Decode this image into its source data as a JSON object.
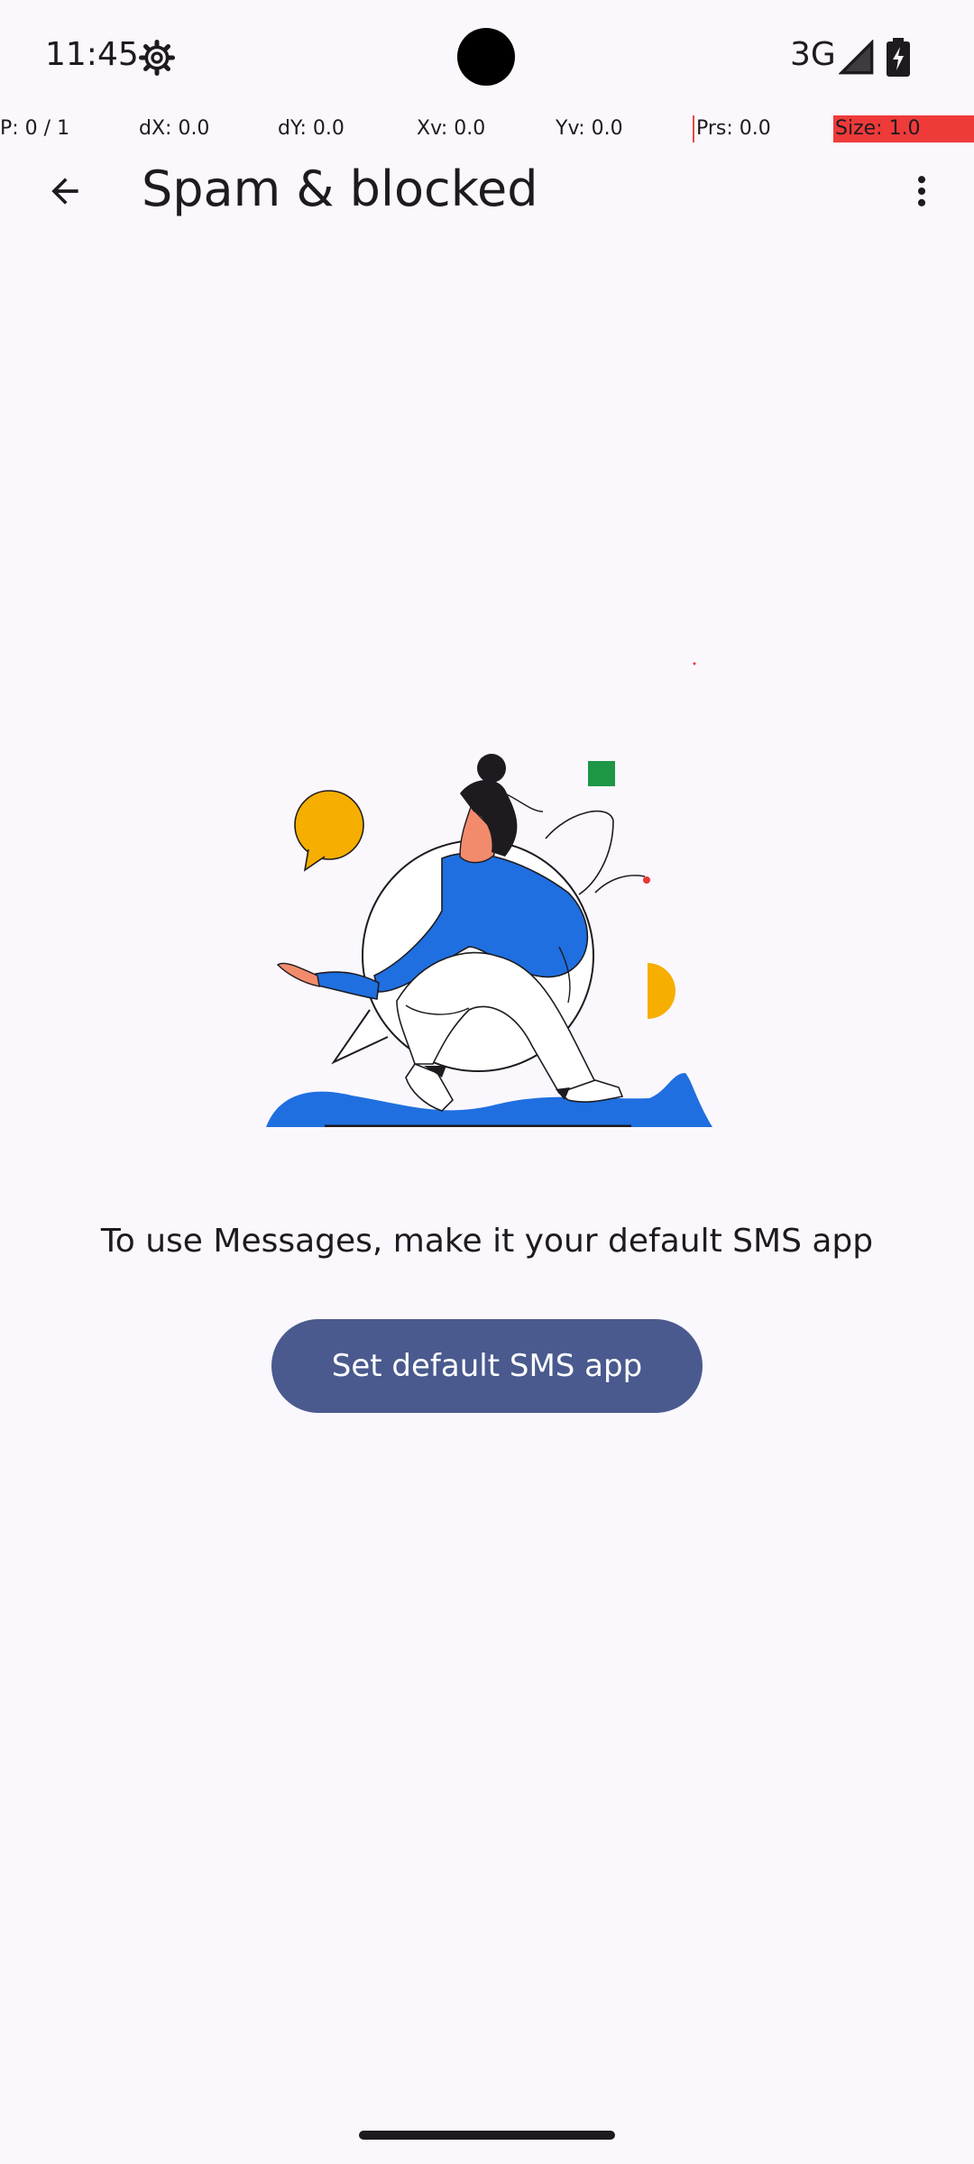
{
  "status_bar": {
    "time": "11:45",
    "network": "3G",
    "icons": [
      "settings-gear-icon",
      "signal-icon",
      "battery-charging-icon"
    ]
  },
  "pointer_overlay": {
    "p": "P: 0 / 1",
    "dx": "dX: 0.0",
    "dy": "dY: 0.0",
    "xv": "Xv: 0.0",
    "yv": "Yv: 0.0",
    "prs": "Prs: 0.0",
    "size": "Size: 1.0"
  },
  "app_bar": {
    "title": "Spam & blocked",
    "back_icon": "arrow-back-icon",
    "menu_icon": "more-vert-icon"
  },
  "empty_state": {
    "message": "To use Messages, make it your default SMS app",
    "button_label": "Set default SMS app"
  },
  "colors": {
    "background": "#faf7fd",
    "button": "#4a5a8e",
    "illustration_blue": "#1f6fe0",
    "illustration_yellow": "#f6ae00",
    "illustration_green": "#1e9646",
    "overlay_red": "#ef3a3a"
  }
}
